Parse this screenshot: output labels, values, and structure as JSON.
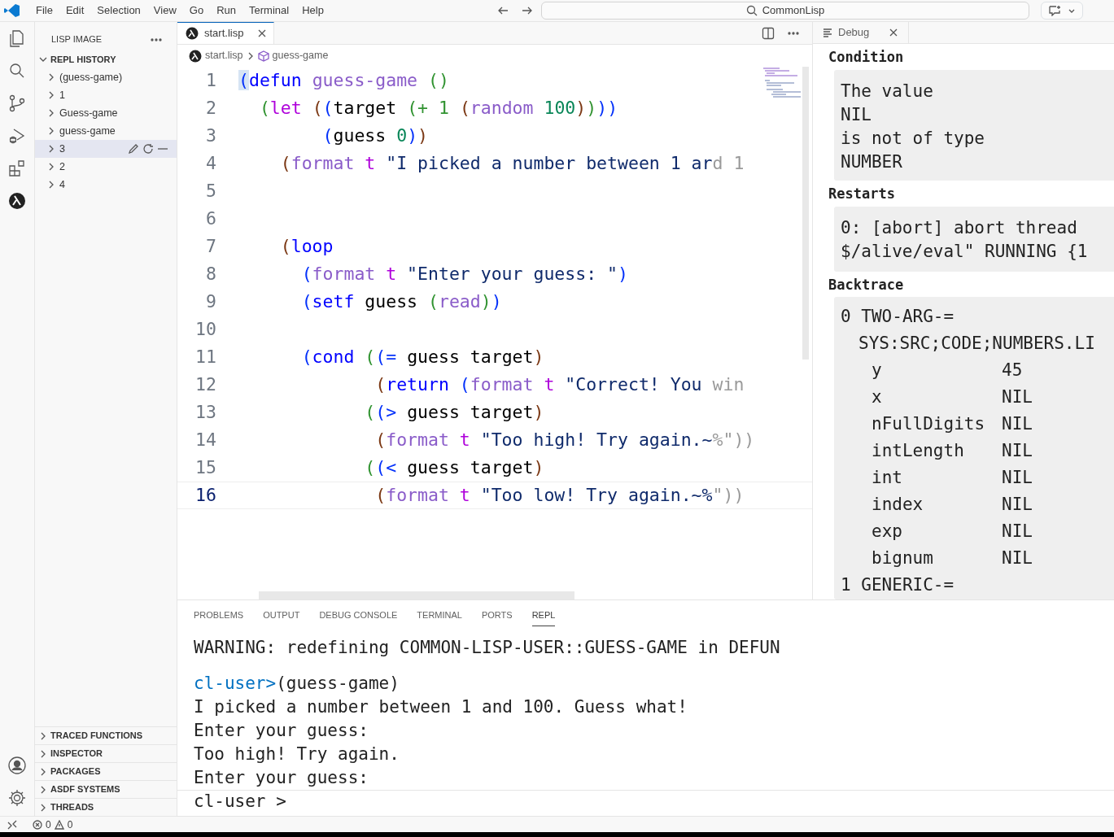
{
  "menu": [
    "File",
    "Edit",
    "Selection",
    "View",
    "Go",
    "Run",
    "Terminal",
    "Help"
  ],
  "command_center": {
    "text": "CommonLisp"
  },
  "sidebar": {
    "title": "LISP IMAGE",
    "history": {
      "title": "REPL HISTORY",
      "expanded": true,
      "items": [
        {
          "label": "(guess-game)",
          "selected": false
        },
        {
          "label": "1",
          "selected": false
        },
        {
          "label": "Guess-game",
          "selected": false
        },
        {
          "label": "guess-game",
          "selected": false
        },
        {
          "label": "3",
          "selected": true
        },
        {
          "label": "2",
          "selected": false
        },
        {
          "label": "4",
          "selected": false
        }
      ]
    },
    "sections": [
      {
        "title": "TRACED FUNCTIONS",
        "expanded": false
      },
      {
        "title": "INSPECTOR",
        "expanded": false
      },
      {
        "title": "PACKAGES",
        "expanded": false
      },
      {
        "title": "ASDF SYSTEMS",
        "expanded": false
      },
      {
        "title": "THREADS",
        "expanded": false
      }
    ]
  },
  "editor": {
    "tabs": [
      {
        "label": "start.lisp",
        "selected": true
      }
    ],
    "breadcrumb": [
      "start.lisp",
      "guess-game"
    ],
    "lines": [
      {
        "number": "1",
        "current": false,
        "tokens": [
          {
            "kind": "match",
            "text": "("
          },
          {
            "kind": "kw",
            "text": "defun "
          },
          {
            "kind": "fn",
            "text": "guess-game "
          },
          {
            "kind": "b2",
            "text": "()"
          }
        ]
      },
      {
        "number": "2",
        "current": false,
        "tokens": [
          {
            "kind": "b2",
            "text": "  ("
          },
          {
            "kind": "macro",
            "text": "let "
          },
          {
            "kind": "b3",
            "text": "("
          },
          {
            "kind": "b1",
            "text": "("
          },
          {
            "kind": "plain",
            "text": "target "
          },
          {
            "kind": "b2",
            "text": "(+ 1 "
          },
          {
            "kind": "b3",
            "text": "("
          },
          {
            "kind": "fn",
            "text": "random "
          },
          {
            "kind": "num",
            "text": "100"
          },
          {
            "kind": "b3",
            "text": ")"
          },
          {
            "kind": "b2",
            "text": ")"
          },
          {
            "kind": "b1",
            "text": "))"
          }
        ]
      },
      {
        "number": "3",
        "current": false,
        "tokens": [
          {
            "kind": "b1",
            "text": "        ("
          },
          {
            "kind": "plain",
            "text": "guess "
          },
          {
            "kind": "num",
            "text": "0"
          },
          {
            "kind": "b1",
            "text": ")"
          },
          {
            "kind": "b3",
            "text": ")"
          }
        ]
      },
      {
        "number": "4",
        "current": false,
        "tokens": [
          {
            "kind": "b3",
            "text": "    ("
          },
          {
            "kind": "fn",
            "text": "format "
          },
          {
            "kind": "macro",
            "text": "t "
          },
          {
            "kind": "str",
            "text": "\"I picked a number between 1 ar"
          },
          {
            "kind": "fade",
            "text": "d 1"
          }
        ]
      },
      {
        "number": "5",
        "current": false
      },
      {
        "number": "6",
        "current": false
      },
      {
        "number": "7",
        "current": false,
        "tokens": [
          {
            "kind": "b3",
            "text": "    ("
          },
          {
            "kind": "kw",
            "text": "loop"
          }
        ]
      },
      {
        "number": "8",
        "current": false,
        "tokens": [
          {
            "kind": "b1",
            "text": "      ("
          },
          {
            "kind": "fn",
            "text": "format "
          },
          {
            "kind": "macro",
            "text": "t "
          },
          {
            "kind": "str",
            "text": "\"Enter your guess: \""
          },
          {
            "kind": "b1",
            "text": ")"
          }
        ]
      },
      {
        "number": "9",
        "current": false,
        "tokens": [
          {
            "kind": "b1",
            "text": "      ("
          },
          {
            "kind": "kw",
            "text": "setf "
          },
          {
            "kind": "plain",
            "text": "guess "
          },
          {
            "kind": "b2",
            "text": "("
          },
          {
            "kind": "fn",
            "text": "read"
          },
          {
            "kind": "b2",
            "text": ")"
          },
          {
            "kind": "b1",
            "text": ")"
          }
        ]
      },
      {
        "number": "10",
        "current": false
      },
      {
        "number": "11",
        "current": false,
        "tokens": [
          {
            "kind": "b1",
            "text": "      ("
          },
          {
            "kind": "kw",
            "text": "cond "
          },
          {
            "kind": "b2",
            "text": "("
          },
          {
            "kind": "b1",
            "text": "(= "
          },
          {
            "kind": "plain",
            "text": "guess target"
          },
          {
            "kind": "b3",
            "text": ")"
          }
        ]
      },
      {
        "number": "12",
        "current": false,
        "tokens": [
          {
            "kind": "b3",
            "text": "             ("
          },
          {
            "kind": "kw",
            "text": "return "
          },
          {
            "kind": "b1",
            "text": "("
          },
          {
            "kind": "fn",
            "text": "format "
          },
          {
            "kind": "macro",
            "text": "t "
          },
          {
            "kind": "str",
            "text": "\"Correct! You"
          },
          {
            "kind": "fade",
            "text": " win"
          }
        ]
      },
      {
        "number": "13",
        "current": false,
        "tokens": [
          {
            "kind": "b2",
            "text": "            ("
          },
          {
            "kind": "b1",
            "text": "(> "
          },
          {
            "kind": "plain",
            "text": "guess target"
          },
          {
            "kind": "b3",
            "text": ")"
          }
        ]
      },
      {
        "number": "14",
        "current": false,
        "tokens": [
          {
            "kind": "b3",
            "text": "             ("
          },
          {
            "kind": "fn",
            "text": "format "
          },
          {
            "kind": "macro",
            "text": "t "
          },
          {
            "kind": "str",
            "text": "\"Too high! Try again.~"
          },
          {
            "kind": "fade",
            "text": "%\"))"
          }
        ]
      },
      {
        "number": "15",
        "current": false,
        "tokens": [
          {
            "kind": "b2",
            "text": "            ("
          },
          {
            "kind": "b1",
            "text": "(< "
          },
          {
            "kind": "plain",
            "text": "guess target"
          },
          {
            "kind": "b3",
            "text": ")"
          }
        ]
      },
      {
        "number": "16",
        "current": true,
        "tokens": [
          {
            "kind": "b3",
            "text": "             ("
          },
          {
            "kind": "fn",
            "text": "format "
          },
          {
            "kind": "macro",
            "text": "t "
          },
          {
            "kind": "str",
            "text": "\"Too low! Try again.~%"
          },
          {
            "kind": "fade",
            "text": "\"))"
          }
        ]
      }
    ]
  },
  "debug": {
    "tab": "Debug",
    "sections": [
      {
        "heading": "Condition",
        "lines": [
          {
            "kind": "text",
            "text": "The value"
          },
          {
            "kind": "text",
            "text": "NIL"
          },
          {
            "kind": "text",
            "text": "is not of type"
          },
          {
            "kind": "text",
            "text": "NUMBER"
          }
        ]
      },
      {
        "heading": "Restarts",
        "lines": [
          {
            "kind": "text",
            "text": "0: [abort] abort thread"
          },
          {
            "kind": "text",
            "text": "$/alive/eval\" RUNNING {1"
          }
        ]
      },
      {
        "heading": "Backtrace",
        "lines": [
          {
            "kind": "frame",
            "index": "0",
            "text": "TWO-ARG-="
          },
          {
            "kind": "location",
            "text": "SYS:SRC;CODE;NUMBERS.LI"
          },
          {
            "kind": "var",
            "name": "y",
            "value": "45"
          },
          {
            "kind": "var",
            "name": "x",
            "value": "NIL"
          },
          {
            "kind": "var",
            "name": "nFullDigits",
            "value": "NIL"
          },
          {
            "kind": "var",
            "name": "intLength",
            "value": "NIL"
          },
          {
            "kind": "var",
            "name": "int",
            "value": "NIL"
          },
          {
            "kind": "var",
            "name": "index",
            "value": "NIL"
          },
          {
            "kind": "var",
            "name": "exp",
            "value": "NIL"
          },
          {
            "kind": "var",
            "name": "bignum",
            "value": "NIL"
          },
          {
            "kind": "frame",
            "index": "1",
            "text": "GENERIC-="
          }
        ]
      }
    ]
  },
  "panel": {
    "tabs": [
      {
        "label": "PROBLEMS",
        "selected": false
      },
      {
        "label": "OUTPUT",
        "selected": false
      },
      {
        "label": "DEBUG CONSOLE",
        "selected": false
      },
      {
        "label": "TERMINAL",
        "selected": false
      },
      {
        "label": "PORTS",
        "selected": false
      },
      {
        "label": "REPL",
        "selected": true
      }
    ],
    "output": [
      {
        "kind": "warning",
        "text": "WARNING: redefining COMMON-LISP-USER::GUESS-GAME in DEFUN"
      },
      {
        "kind": "prompt",
        "prompt": "cl-user>",
        "text": "(guess-game)"
      },
      {
        "kind": "text",
        "text": "I picked a number between 1 and 100. Guess what!"
      },
      {
        "kind": "text",
        "text": "Enter your guess:"
      },
      {
        "kind": "text",
        "text": "Too high! Try again."
      },
      {
        "kind": "text",
        "text": "Enter your guess:"
      }
    ],
    "input": {
      "prompt": "cl-user >"
    }
  },
  "status_bar": {
    "errors": "0",
    "warnings": "0"
  }
}
